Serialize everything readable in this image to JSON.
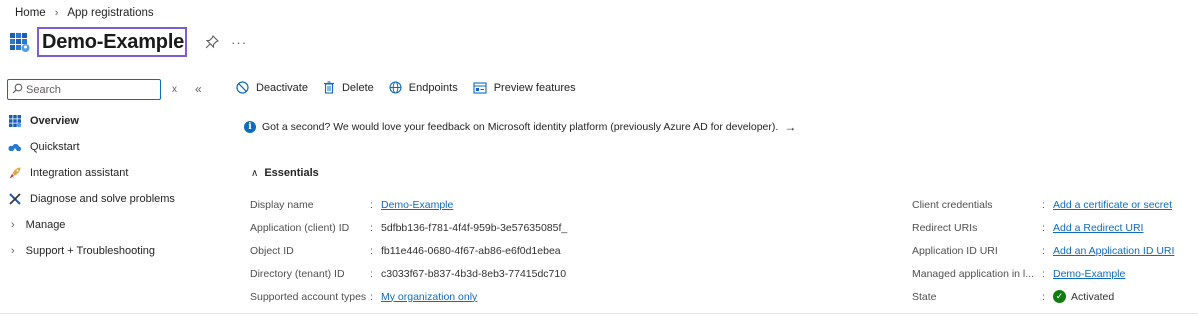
{
  "breadcrumb": {
    "home": "Home",
    "current": "App registrations"
  },
  "page": {
    "title": "Demo-Example",
    "more_label": "···"
  },
  "search": {
    "placeholder": "Search",
    "collapse_x": "x",
    "collapse_arrows": "«"
  },
  "nav": {
    "items": [
      {
        "label": "Overview",
        "icon": "grid-icon"
      },
      {
        "label": "Quickstart",
        "icon": "cloud-icon"
      },
      {
        "label": "Integration assistant",
        "icon": "rocket-icon"
      },
      {
        "label": "Diagnose and solve problems",
        "icon": "wrench-icon"
      },
      {
        "label": "Manage",
        "icon": "chevron-right-icon"
      },
      {
        "label": "Support + Troubleshooting",
        "icon": "chevron-right-icon"
      }
    ]
  },
  "toolbar": {
    "deactivate": "Deactivate",
    "delete": "Delete",
    "endpoints": "Endpoints",
    "preview": "Preview features"
  },
  "feedback": {
    "text": "Got a second? We would love your feedback on Microsoft identity platform (previously Azure AD for developer).",
    "arrow": "→"
  },
  "essentials": {
    "label": "Essentials",
    "caret": "∧"
  },
  "properties_left": [
    {
      "label": "Display name",
      "value": "Demo-Example",
      "link": true
    },
    {
      "label": "Application (client) ID",
      "value": "5dfbb136-f781-4f4f-959b-3e57635085f_",
      "link": false
    },
    {
      "label": "Object ID",
      "value": "fb11e446-0680-4f67-ab86-e6f0d1ebea",
      "link": false
    },
    {
      "label": "Directory (tenant) ID",
      "value": "c3033f67-b837-4b3d-8eb3-77415dc710",
      "link": false
    },
    {
      "label": "Supported account types",
      "value": "My organization only",
      "link": true
    }
  ],
  "properties_right": [
    {
      "label": "Client credentials",
      "value": "Add a certificate or secret",
      "link": true
    },
    {
      "label": "Redirect URIs",
      "value": "Add a Redirect URI",
      "link": true
    },
    {
      "label": "Application ID URI",
      "value": "Add an Application ID URI",
      "link": true
    },
    {
      "label": "Managed application in l...",
      "value": "Demo-Example",
      "link": true
    },
    {
      "label": "State",
      "value": "Activated",
      "link": false
    }
  ],
  "colors": {
    "accent": "#0f6cbd",
    "title_border": "#7f5bd6",
    "success": "#107c10"
  }
}
